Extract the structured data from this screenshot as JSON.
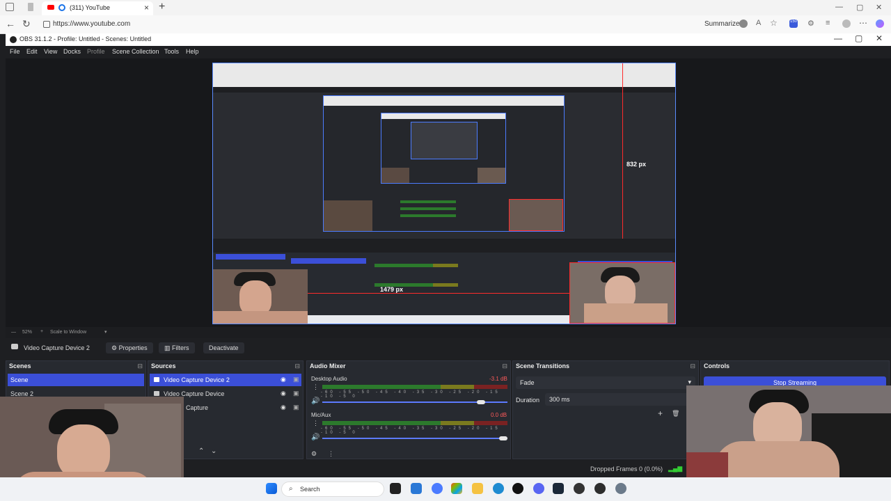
{
  "browser": {
    "tab_title": "(311) YouTube",
    "url": "https://www.youtube.com",
    "summarize_label": "Summarize",
    "badge": "150"
  },
  "obs": {
    "window_title": "OBS 31.1.2 - Profile: Untitled - Scenes: Untitled",
    "menu": [
      "File",
      "Edit",
      "View",
      "Docks",
      "Profile",
      "Scene Collection",
      "Tools",
      "Help"
    ],
    "measure_vertical": "832 px",
    "measure_horizontal": "1479 px",
    "zoom": "52%",
    "scale_mode": "Scale to Window",
    "selected_source": "Video Capture Device 2",
    "properties_label": "Properties",
    "filters_label": "Filters",
    "deactivate_label": "Deactivate",
    "scenes": {
      "title": "Scenes",
      "items": [
        "Scene",
        "Scene 2"
      ]
    },
    "sources": {
      "title": "Sources",
      "items": [
        "Video Capture Device 2",
        "Video Capture Device",
        "Capture"
      ]
    },
    "audio_mixer": {
      "title": "Audio Mixer",
      "channels": [
        {
          "name": "Desktop Audio",
          "level": "-3.1 dB",
          "volume": 0.88
        },
        {
          "name": "Mic/Aux",
          "level": "0.0 dB",
          "volume": 1.0
        }
      ],
      "scale": [
        "-60",
        "-55",
        "-50",
        "-45",
        "-40",
        "-35",
        "-30",
        "-25",
        "-20",
        "-15",
        "-10",
        "-5",
        "0"
      ]
    },
    "scene_transitions": {
      "title": "Scene Transitions",
      "transition": "Fade",
      "duration_label": "Duration",
      "duration_value": "300 ms"
    },
    "controls": {
      "title": "Controls",
      "stop_streaming": "Stop Streaming"
    },
    "status": {
      "dropped_frames": "Dropped Frames 0 (0.0%)"
    }
  },
  "taskbar": {
    "search_placeholder": "Search"
  },
  "colors": {
    "accent": "#3b4fd8",
    "red_guide": "#ff2b2b",
    "selection_border": "#5a8cff"
  }
}
